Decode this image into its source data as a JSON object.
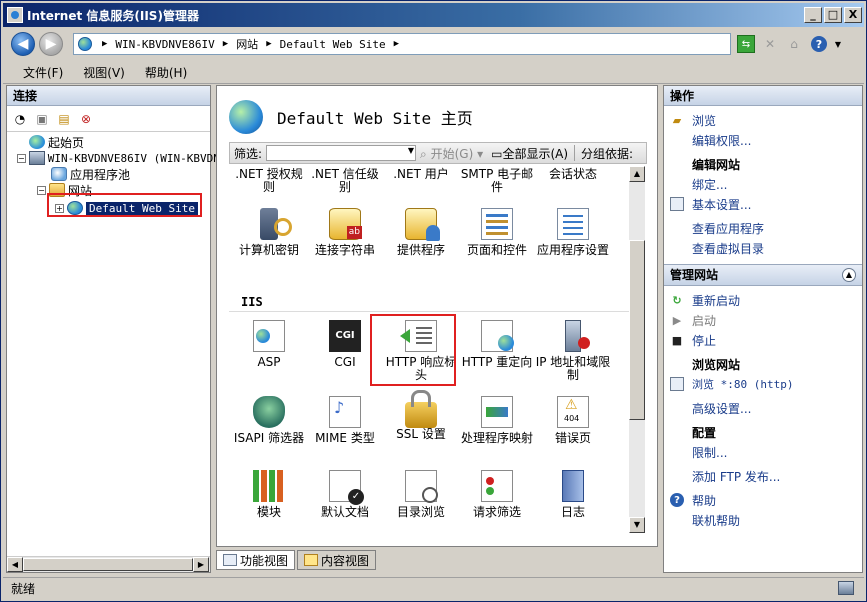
{
  "window": {
    "title": "Internet 信息服务(IIS)管理器",
    "controls": {
      "minimize": "_",
      "maximize": "□",
      "close": "X"
    }
  },
  "address": {
    "path": [
      "WIN-KBVDNVE86IV",
      "网站",
      "Default Web Site"
    ],
    "separator": "▶"
  },
  "menu": [
    "文件(F)",
    "视图(V)",
    "帮助(H)"
  ],
  "left_panel": {
    "header": "连接",
    "tree": [
      {
        "label": "起始页",
        "level": 0,
        "expander": "",
        "icon": "home-icon"
      },
      {
        "label": "WIN-KBVDNVE86IV (WIN-KBVDN",
        "level": 0,
        "expander": "−",
        "icon": "server-icon"
      },
      {
        "label": "应用程序池",
        "level": 1,
        "expander": "",
        "icon": "app-pool-icon"
      },
      {
        "label": "网站",
        "level": 1,
        "expander": "−",
        "icon": "folder-icon"
      },
      {
        "label": "Default Web Site",
        "level": 2,
        "expander": "+",
        "icon": "globe-icon",
        "selected": true
      }
    ]
  },
  "center": {
    "title": "Default Web Site 主页",
    "filter": {
      "label": "筛选:",
      "start": "开始(G)",
      "show_all": "全部显示(A)",
      "group_by": "分组依据:"
    },
    "top_row": [
      {
        "label": ".NET 授权规则",
        "icon": "net-auth-icon"
      },
      {
        "label": ".NET 信任级别",
        "icon": "net-trust-icon"
      },
      {
        "label": ".NET 用户",
        "icon": "net-users-icon"
      },
      {
        "label": "SMTP 电子邮件",
        "icon": "smtp-icon"
      },
      {
        "label": "会话状态",
        "icon": "session-state-icon"
      }
    ],
    "aspnet_row": [
      {
        "label": "计算机密钥",
        "icon": "machine-key-icon",
        "cls": "fi-keys"
      },
      {
        "label": "连接字符串",
        "icon": "connection-strings-icon",
        "cls": "fi-db"
      },
      {
        "label": "提供程序",
        "icon": "providers-icon",
        "cls": "fi-provider"
      },
      {
        "label": "页面和控件",
        "icon": "pages-controls-icon",
        "cls": "fi-pages"
      },
      {
        "label": "应用程序设置",
        "icon": "app-settings-icon",
        "cls": "fi-appset"
      }
    ],
    "iis_section": "IIS",
    "iis_rows": [
      [
        {
          "label": "ASP",
          "icon": "asp-icon",
          "cls": "fi-asp"
        },
        {
          "label": "CGI",
          "icon": "cgi-icon",
          "cls": "fi-cgi",
          "glyph": "CGI"
        },
        {
          "label": "HTTP 响应标头",
          "icon": "http-headers-icon",
          "cls": "fi-http",
          "highlighted": true
        },
        {
          "label": "HTTP 重定向",
          "icon": "http-redirect-icon",
          "cls": "fi-redirect"
        },
        {
          "label": "IP 地址和域限制",
          "icon": "ip-restrictions-icon",
          "cls": "fi-ip"
        }
      ],
      [
        {
          "label": "ISAPI 筛选器",
          "icon": "isapi-filters-icon",
          "cls": "fi-isapi"
        },
        {
          "label": "MIME 类型",
          "icon": "mime-types-icon",
          "cls": "fi-mime"
        },
        {
          "label": "SSL 设置",
          "icon": "ssl-lock-icon",
          "cls": "fi-ssl"
        },
        {
          "label": "处理程序映射",
          "icon": "handler-mappings-icon",
          "cls": "fi-handler"
        },
        {
          "label": "错误页",
          "icon": "error-pages-icon",
          "cls": "fi-error"
        }
      ],
      [
        {
          "label": "模块",
          "icon": "modules-icon",
          "cls": "fi-modules"
        },
        {
          "label": "默认文档",
          "icon": "default-document-icon",
          "cls": "fi-defdoc"
        },
        {
          "label": "目录浏览",
          "icon": "directory-browsing-icon",
          "cls": "fi-browse"
        },
        {
          "label": "请求筛选",
          "icon": "request-filtering-icon",
          "cls": "fi-reqfilter"
        },
        {
          "label": "日志",
          "icon": "logging-icon",
          "cls": "fi-log"
        }
      ]
    ],
    "view_tabs": [
      "功能视图",
      "内容视图"
    ]
  },
  "right_panel": {
    "header": "操作",
    "group1": [
      {
        "label": "浏览",
        "icon": "explore-icon",
        "type": "link"
      },
      {
        "label": "编辑权限...",
        "icon": "",
        "type": "link"
      },
      {
        "label": "编辑网站",
        "type": "heading"
      },
      {
        "label": "绑定...",
        "icon": "",
        "type": "link"
      },
      {
        "label": "基本设置...",
        "icon": "basic-settings-icon",
        "type": "link"
      },
      {
        "label": "查看应用程序",
        "icon": "",
        "type": "link"
      },
      {
        "label": "查看虚拟目录",
        "icon": "",
        "type": "link"
      }
    ],
    "manage_header": "管理网站",
    "group2": [
      {
        "label": "重新启动",
        "icon": "restart-icon",
        "type": "link"
      },
      {
        "label": "启动",
        "icon": "start-icon",
        "type": "link",
        "disabled": true
      },
      {
        "label": "停止",
        "icon": "stop-icon",
        "type": "link"
      },
      {
        "label": "浏览网站",
        "type": "heading"
      },
      {
        "label": "浏览 *:80 (http)",
        "icon": "browse-site-icon",
        "type": "link",
        "mono": true
      },
      {
        "label": "高级设置...",
        "icon": "",
        "type": "link"
      },
      {
        "label": "配置",
        "type": "heading"
      },
      {
        "label": "限制...",
        "icon": "",
        "type": "link"
      },
      {
        "label": "添加 FTP 发布...",
        "icon": "",
        "type": "link"
      },
      {
        "label": "帮助",
        "icon": "help-icon",
        "type": "link"
      },
      {
        "label": "联机帮助",
        "icon": "",
        "type": "link"
      }
    ]
  },
  "status": {
    "text": "就绪"
  },
  "colors": {
    "highlight": "#e02020",
    "selection": "#0a246a",
    "link": "#1a3c8a"
  }
}
